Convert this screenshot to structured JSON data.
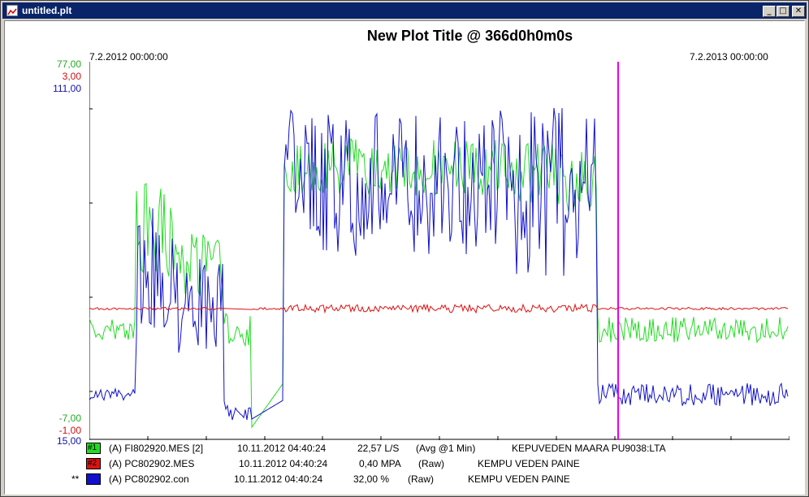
{
  "window": {
    "title": "untitled.plt",
    "minimize": "_",
    "maximize": "□",
    "close": "✕"
  },
  "plot": {
    "title": "New Plot Title  @ 366d0h0m0s",
    "start_time": "7.2.2012  00:00:00",
    "end_time": "7.2.2013  00:00:00",
    "colors": {
      "series1": "#22dd22",
      "series2": "#dd1111",
      "series3": "#1111cc",
      "cursor": "#ee00ee"
    }
  },
  "axes": {
    "top": [
      "77,00",
      "3,00",
      "111,00"
    ],
    "bottom": [
      "-7,00",
      "-1,00",
      "15,00"
    ]
  },
  "chart_data": {
    "type": "line",
    "series": [
      {
        "name": "FI802920.MES [2]",
        "ylim": [
          -7,
          77
        ]
      },
      {
        "name": "PC802902.MES",
        "ylim": [
          -1,
          3
        ]
      },
      {
        "name": "PC802902.con",
        "ylim": [
          15,
          111
        ]
      }
    ]
  },
  "legend": [
    {
      "marker": "#1",
      "text": "(A) FI802920.MES [2]",
      "time": "10.11.2012 04:40:24",
      "value": "22,57 L/S",
      "mode": "(Avg @1 Min)",
      "desc": "KEPUVEDEN MAARA PU9038:LTA"
    },
    {
      "marker": "#2",
      "text": "(A) PC802902.MES",
      "time": "10.11.2012 04:40:24",
      "value": "0,40 MPA",
      "mode": "(Raw)",
      "desc": "KEMPU VEDEN PAINE"
    },
    {
      "marker": "",
      "prefix": "**",
      "text": "(A) PC802902.con",
      "time": "10.11.2012 04:40:24",
      "value": "32,00 %",
      "mode": "(Raw)",
      "desc": "KEMPU VEDEN PAINE"
    }
  ]
}
